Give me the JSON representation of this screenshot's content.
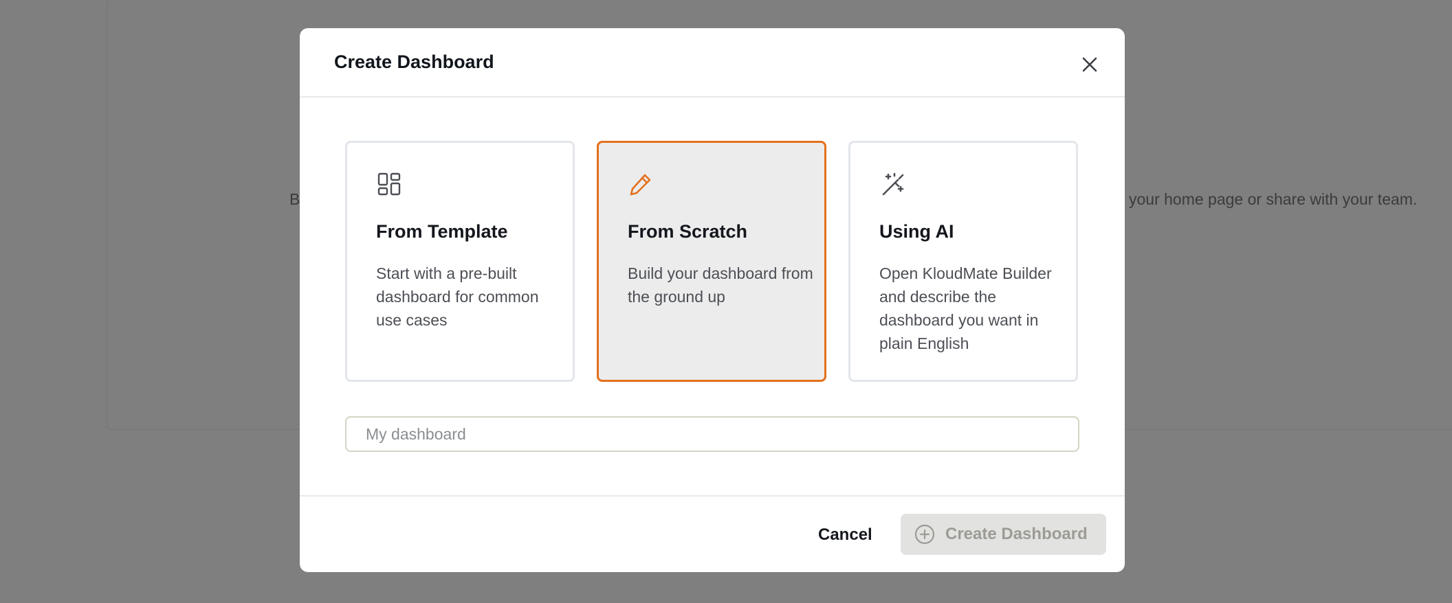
{
  "background": {
    "text_left": "B",
    "text_right": "your home page or share with your team."
  },
  "modal": {
    "title": "Create Dashboard",
    "close_icon": "close-icon",
    "options": [
      {
        "title": "From Template",
        "description": "Start with a pre-built dashboard for common use cases",
        "icon": "layout-grid-icon",
        "selected": false
      },
      {
        "title": "From Scratch",
        "description": "Build your dashboard from the ground up",
        "icon": "pencil-icon",
        "selected": true
      },
      {
        "title": "Using AI",
        "description": "Open KloudMate Builder and describe the dashboard you want in plain English",
        "icon": "magic-wand-icon",
        "selected": false
      }
    ],
    "name_input": {
      "placeholder": "My dashboard",
      "value": ""
    },
    "footer": {
      "cancel_label": "Cancel",
      "create_label": "Create Dashboard",
      "create_icon": "plus-circle-icon"
    }
  },
  "colors": {
    "accent": "#e4701c",
    "overlay": "#7f7f7f",
    "selected_card_bg": "#ececec",
    "disabled_button_bg": "#e2e2e0",
    "disabled_button_text": "#9d9b95"
  }
}
